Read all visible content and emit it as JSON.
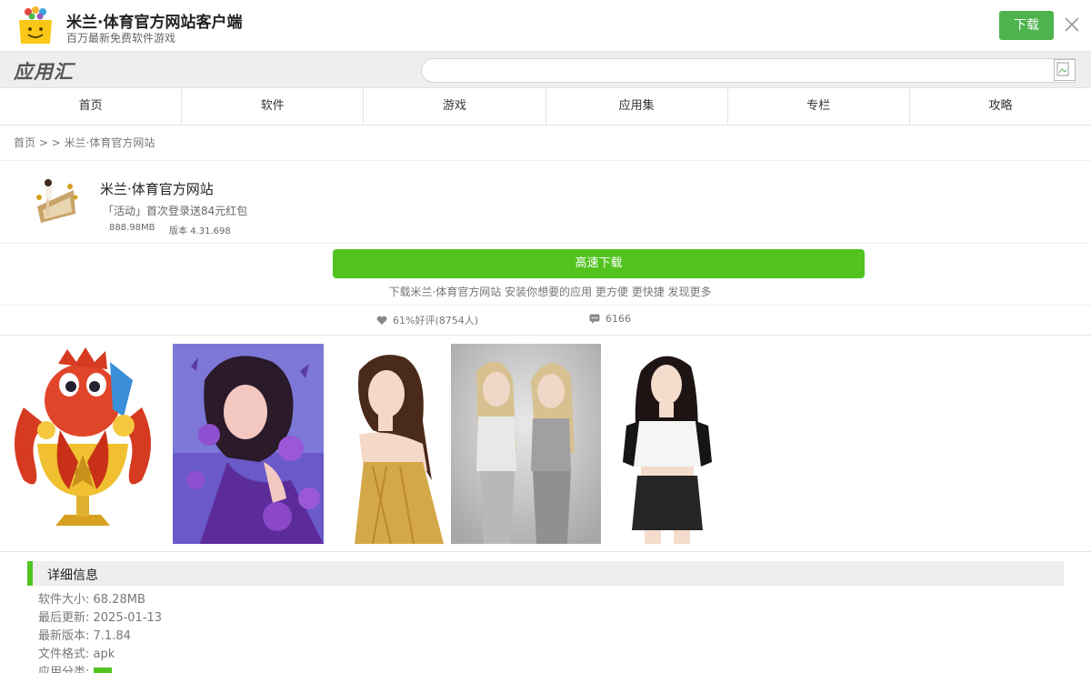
{
  "topbar": {
    "title": "米兰·体育官方网站客户端",
    "subtitle": "百万最新免费软件游戏",
    "download_label": "下载"
  },
  "header": {
    "logo_text": "应用汇",
    "search_placeholder": ""
  },
  "nav": [
    "首页",
    "软件",
    "游戏",
    "应用集",
    "专栏",
    "攻略"
  ],
  "breadcrumb": "首页 > > 米兰·体育官方网站",
  "app": {
    "name": "米兰·体育官方网站",
    "promo": "「活动」首次登录送84元红包",
    "size": "888.98MB",
    "version": "版本 4.31.698"
  },
  "download": {
    "button_label": "高速下载",
    "description": "下载米兰·体育官方网站 安装你想要的应用 更方便 更快捷 发现更多"
  },
  "stats": {
    "rating": "61%好评(8754人)",
    "comments": "6166"
  },
  "details": {
    "title": "详细信息",
    "size": "软件大小: 68.28MB",
    "updated": "最后更新: 2025-01-13",
    "version": "最新版本: 7.1.84",
    "format": "文件格式: apk",
    "category_label": "应用分类: "
  },
  "colors": {
    "accent_green": "#52c31f",
    "top_download_green": "#4db34d"
  }
}
